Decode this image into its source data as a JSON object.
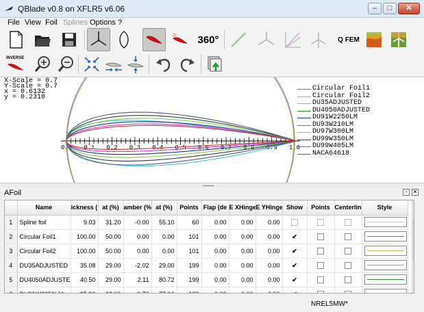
{
  "window": {
    "title": "QBlade v0.8 on XFLR5 v6.06",
    "controls": {
      "minimize": "–",
      "maximize": "□",
      "close": "✕"
    }
  },
  "menu": [
    "File",
    "View",
    "Foil",
    "Splines",
    "Options",
    "?"
  ],
  "menu_disabled": [
    "Splines"
  ],
  "toolbar1": [
    {
      "name": "new-icon",
      "active": false
    },
    {
      "name": "open-icon",
      "active": false
    },
    {
      "name": "save-icon",
      "active": false
    },
    {
      "name": "rotor-blade-icon",
      "active": true
    },
    {
      "name": "airfoil-outline-icon",
      "active": false
    },
    {
      "name": "airfoil-design-icon",
      "active": true
    },
    {
      "name": "xfoil-analysis-icon",
      "active": false
    },
    {
      "name": "polar-360-button",
      "text": "360°",
      "active": false
    },
    {
      "name": "line-tool-icon",
      "active": false
    },
    {
      "name": "turbine-icon",
      "active": false
    },
    {
      "name": "graph-icon",
      "active": false
    },
    {
      "name": "turbine-sim-icon",
      "active": false
    },
    {
      "name": "qfem-button",
      "text": "Q FEM",
      "active": false
    },
    {
      "name": "fem-map-icon",
      "active": false
    },
    {
      "name": "hawt-icon",
      "active": false
    }
  ],
  "toolbar2": [
    {
      "name": "inverse-design-button",
      "text": "INVERSE"
    },
    {
      "name": "zoom-in-icon"
    },
    {
      "name": "zoom-out-icon"
    },
    {
      "name": "reset-scale-icon"
    },
    {
      "name": "x-scale-icon"
    },
    {
      "name": "y-scale-icon"
    },
    {
      "name": "undo-icon"
    },
    {
      "name": "redo-icon"
    },
    {
      "name": "export-icon"
    }
  ],
  "readout": {
    "x_scale": "X-Scale = 0.7",
    "y_scale": "Y-Scale = 0.7",
    "x": "x = 0.6132",
    "y": "y = 0.2310"
  },
  "chart_data": {
    "type": "line",
    "xlabel": "",
    "ylabel": "",
    "x_ticks": [
      "0.0",
      "0.1",
      "0.2",
      "0.3",
      "0.4",
      "0.5",
      "0.6",
      "0.7",
      "0.8",
      "0.9",
      "1.0"
    ],
    "xlim": [
      0,
      1
    ],
    "legend_position": "right",
    "series": [
      {
        "name": "Circular Foil1",
        "color": "#7a6a9e",
        "max_thickness": 1.0,
        "camber": 0.0
      },
      {
        "name": "Circular Foil2",
        "color": "#b8b35a",
        "max_thickness": 1.0,
        "camber": 0.0
      },
      {
        "name": "DU35ADJUSTED",
        "color": "#3fc9d3",
        "max_thickness": 0.3508,
        "camber": -0.0202
      },
      {
        "name": "DU4050ADJUSTED",
        "color": "#2f8a2f",
        "max_thickness": 0.405,
        "camber": 0.0211
      },
      {
        "name": "DU91W2250LM",
        "color": "#1e2f8f",
        "max_thickness": 0.25,
        "camber": 0.027
      },
      {
        "name": "DU93W210LM",
        "color": "#c838c8",
        "max_thickness": 0.21,
        "camber": 0.03
      },
      {
        "name": "DU97W300LM",
        "color": "#7ccf55",
        "max_thickness": 0.3,
        "camber": 0.028
      },
      {
        "name": "DU99W350LM",
        "color": "#3a3a3a",
        "max_thickness": 0.35,
        "camber": 0.025
      },
      {
        "name": "DU99W405LM",
        "color": "#6e6e9e",
        "max_thickness": 0.405,
        "camber": 0.022
      },
      {
        "name": "NACA64618",
        "color": "#c83232",
        "max_thickness": 0.18,
        "camber": 0.033
      }
    ]
  },
  "dock": {
    "title": "AFoil",
    "float": "▫",
    "close": "✕"
  },
  "table": {
    "headers": [
      "",
      "Name",
      "ickness (",
      "at (%)",
      "amber (%",
      "at (%)",
      "Points",
      "Flap (de",
      "E XHinge",
      "E YHinge",
      "Show",
      "Points",
      "Centerline",
      "Style"
    ],
    "rows": [
      {
        "idx": "1",
        "name": "Spline foil",
        "thickness": "9.03",
        "t_at": "31.20",
        "camber": "-0.00",
        "c_at": "55.10",
        "points": "60",
        "flap": "0.00",
        "xhinge": "0.00",
        "yhinge": "0.00",
        "show": false,
        "show_points": false,
        "centerline": false,
        "color": "#c8c8c8"
      },
      {
        "idx": "2",
        "name": "Circular Foil1",
        "thickness": "100.00",
        "t_at": "50.00",
        "camber": "0.00",
        "c_at": "0.00",
        "points": "101",
        "flap": "0.00",
        "xhinge": "0.00",
        "yhinge": "0.00",
        "show": true,
        "show_points": false,
        "centerline": false,
        "color": "#7a6a9e"
      },
      {
        "idx": "3",
        "name": "Circular Foil2",
        "thickness": "100.00",
        "t_at": "50.00",
        "camber": "0.00",
        "c_at": "0.00",
        "points": "101",
        "flap": "0.00",
        "xhinge": "0.00",
        "yhinge": "0.00",
        "show": true,
        "show_points": false,
        "centerline": false,
        "color": "#b8b35a"
      },
      {
        "idx": "4",
        "name": "DU35ADJUSTED",
        "thickness": "35.08",
        "t_at": "29.00",
        "camber": "-2.02",
        "c_at": "29.00",
        "points": "199",
        "flap": "0.00",
        "xhinge": "0.00",
        "yhinge": "0.00",
        "show": true,
        "show_points": false,
        "centerline": false,
        "color": "#3fc9d3"
      },
      {
        "idx": "5",
        "name": "DU4050ADJUSTED",
        "thickness": "40.50",
        "t_at": "29.00",
        "camber": "2.11",
        "c_at": "80.72",
        "points": "199",
        "flap": "0.00",
        "xhinge": "0.00",
        "yhinge": "0.00",
        "show": true,
        "show_points": false,
        "centerline": false,
        "color": "#2f8a2f"
      },
      {
        "idx": "6",
        "name": "DU91W2250LM",
        "thickness": "25.00",
        "t_at": "32.00",
        "camber": "2.70",
        "c_at": "77.04",
        "points": "199",
        "flap": "0.00",
        "xhinge": "0.00",
        "yhinge": "0.00",
        "show": true,
        "show_points": false,
        "centerline": false,
        "color": "#1e2f8f"
      }
    ]
  },
  "status": {
    "text": "NREL5MW*"
  }
}
